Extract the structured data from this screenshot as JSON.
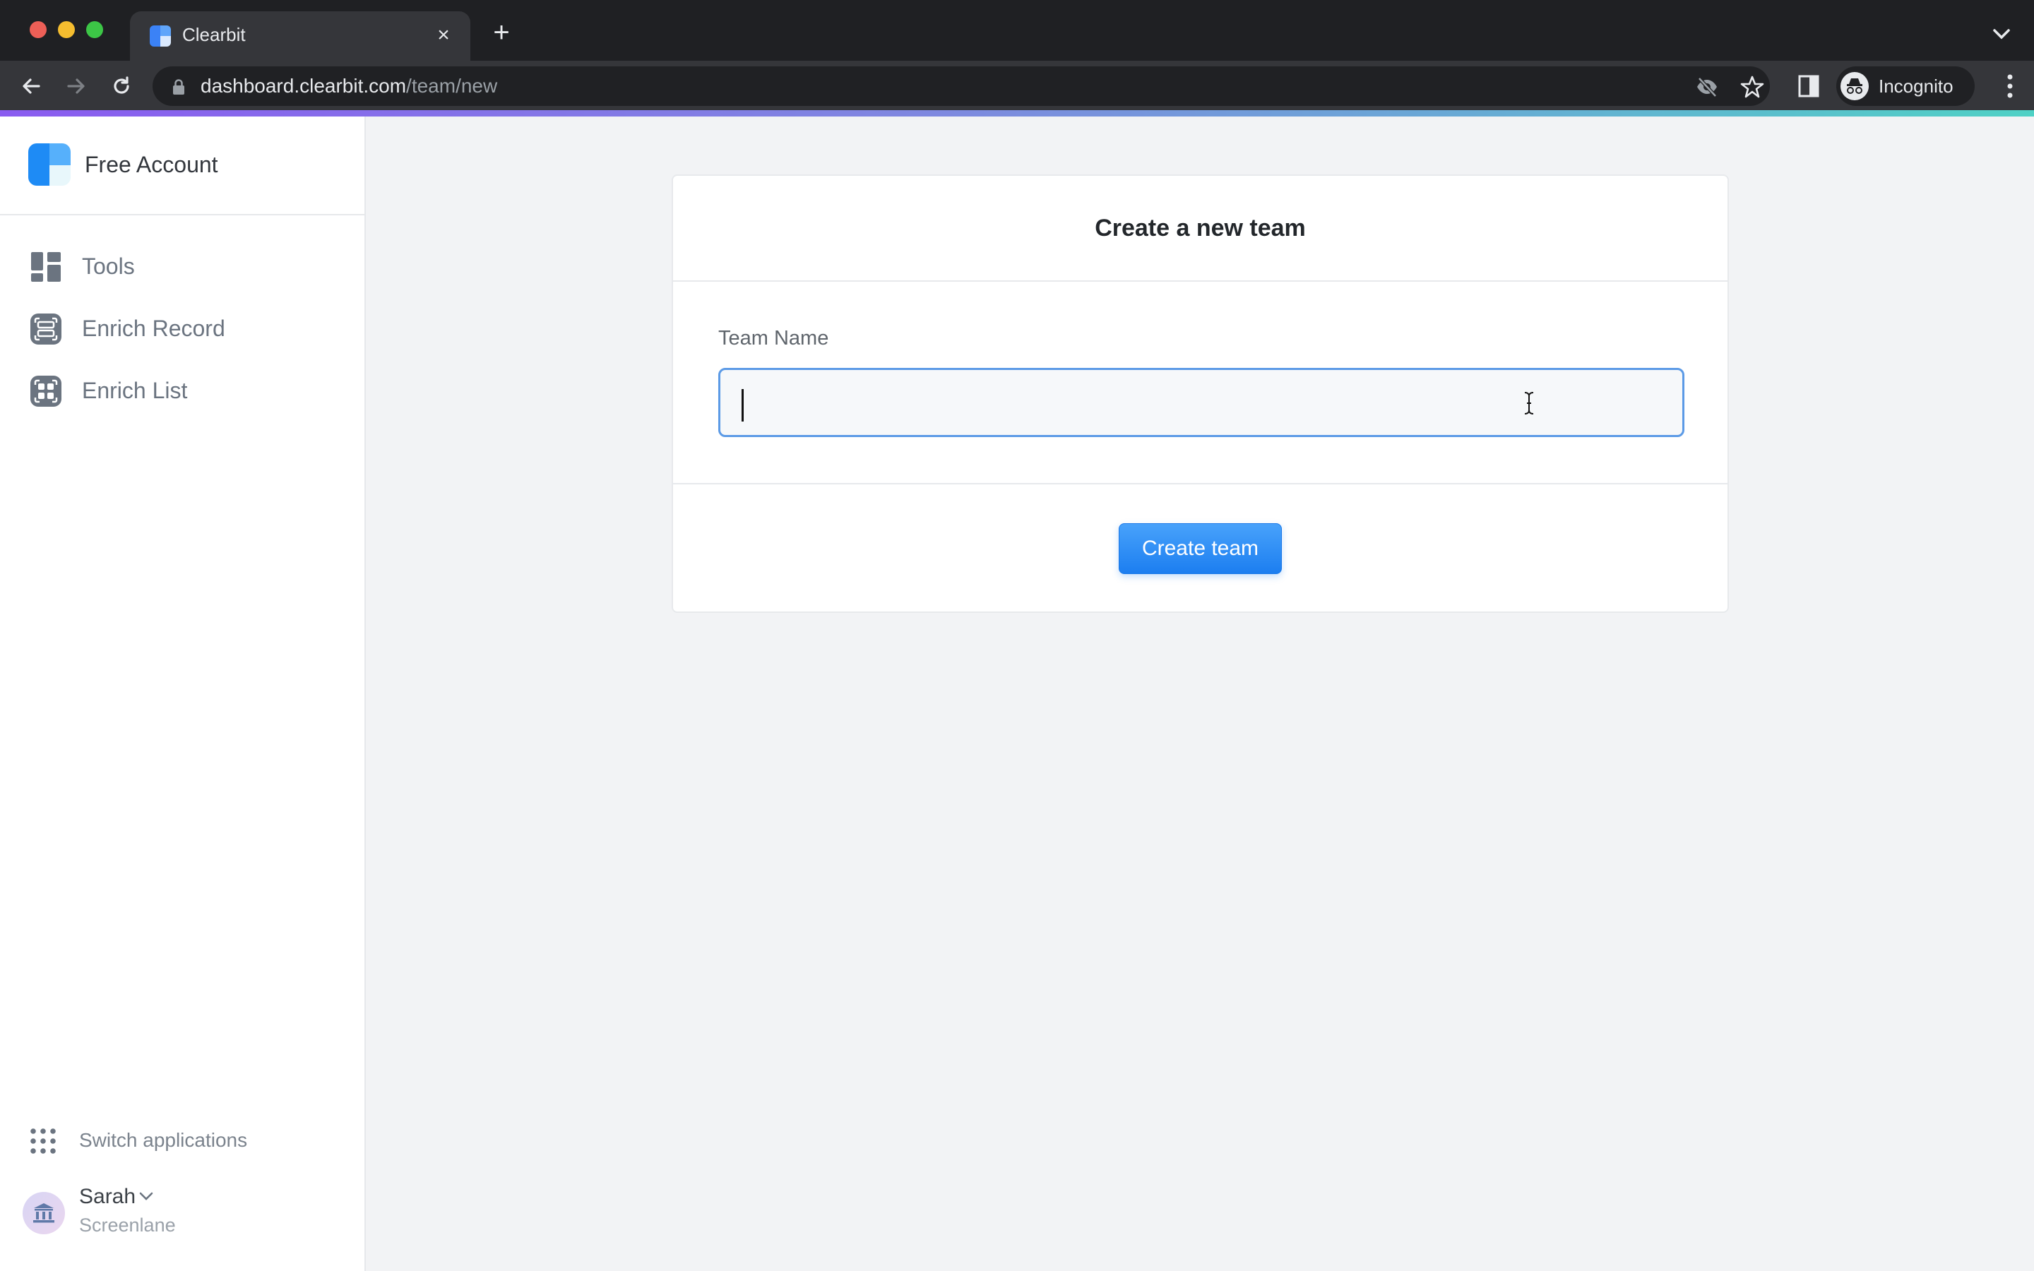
{
  "browser": {
    "tab": {
      "title": "Clearbit",
      "close_glyph": "×"
    },
    "new_tab_glyph": "+",
    "url": {
      "host": "dashboard.clearbit.com",
      "path": "/team/new"
    },
    "profile_label": "Incognito",
    "icons": [
      "back-icon",
      "forward-icon",
      "reload-icon",
      "lock-icon",
      "eye-off-icon",
      "star-icon",
      "side-panel-icon",
      "incognito-icon",
      "kebab-menu-icon",
      "tab-search-chevron-icon"
    ]
  },
  "sidebar": {
    "account_name": "Free Account",
    "items": [
      {
        "label": "Tools",
        "icon": "dashboard-grid-icon"
      },
      {
        "label": "Enrich Record",
        "icon": "enrich-record-icon"
      },
      {
        "label": "Enrich List",
        "icon": "enrich-list-icon"
      }
    ],
    "switch_apps_label": "Switch applications",
    "user": {
      "name": "Sarah",
      "org": "Screenlane",
      "avatar_icon": "bank-icon"
    }
  },
  "card": {
    "title": "Create a new team",
    "field_label": "Team Name",
    "field_value": "",
    "submit_label": "Create team"
  },
  "colors": {
    "accent": "#1e88f5",
    "input_focus_border": "#5b9ae6",
    "gradient_start": "#8a5cf0",
    "gradient_end": "#4fd1c5"
  }
}
